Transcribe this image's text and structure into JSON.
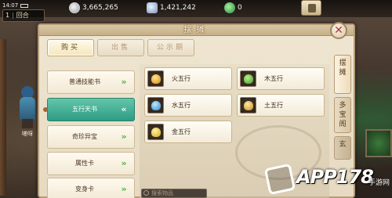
{
  "status_bar": {
    "time": "14:07"
  },
  "layer": {
    "value": "1",
    "label": "回合"
  },
  "resources": [
    {
      "name": "silver",
      "icon": "silver-coin-icon",
      "value": "3,665,265"
    },
    {
      "name": "crystal",
      "icon": "crystal-icon",
      "value": "1,421,242"
    },
    {
      "name": "jade",
      "icon": "jade-icon",
      "value": "0"
    }
  ],
  "panel": {
    "title": "摆摊"
  },
  "tabs": [
    {
      "label": "购买",
      "active": true
    },
    {
      "label": "出售",
      "active": false
    },
    {
      "label": "公示期",
      "active": false
    }
  ],
  "categories": [
    {
      "label": "普通技能书",
      "active": false
    },
    {
      "label": "五行天书",
      "active": true
    },
    {
      "label": "奇珍异宝",
      "active": false
    },
    {
      "label": "属性卡",
      "active": false
    },
    {
      "label": "变身卡",
      "active": false
    }
  ],
  "items": [
    {
      "label": "火五行",
      "icon": "fire-gem-icon"
    },
    {
      "label": "木五行",
      "icon": "wood-gem-icon"
    },
    {
      "label": "水五行",
      "icon": "water-gem-icon"
    },
    {
      "label": "土五行",
      "icon": "earth-gem-icon"
    },
    {
      "label": "金五行",
      "icon": "metal-gem-icon"
    }
  ],
  "search": {
    "placeholder": "搜索物品"
  },
  "side_tabs": [
    {
      "label": "摆摊",
      "active": true
    },
    {
      "label": "多宝阁",
      "active": false
    },
    {
      "label": "玄",
      "active": false
    }
  ],
  "character": {
    "name": "嗟呀"
  },
  "watermark": {
    "text": "APP178",
    "sub": "手游网"
  },
  "colors": {
    "active_category": "#2e9c84",
    "panel_bg": "#efe6d2",
    "close_x": "#b0383a"
  }
}
